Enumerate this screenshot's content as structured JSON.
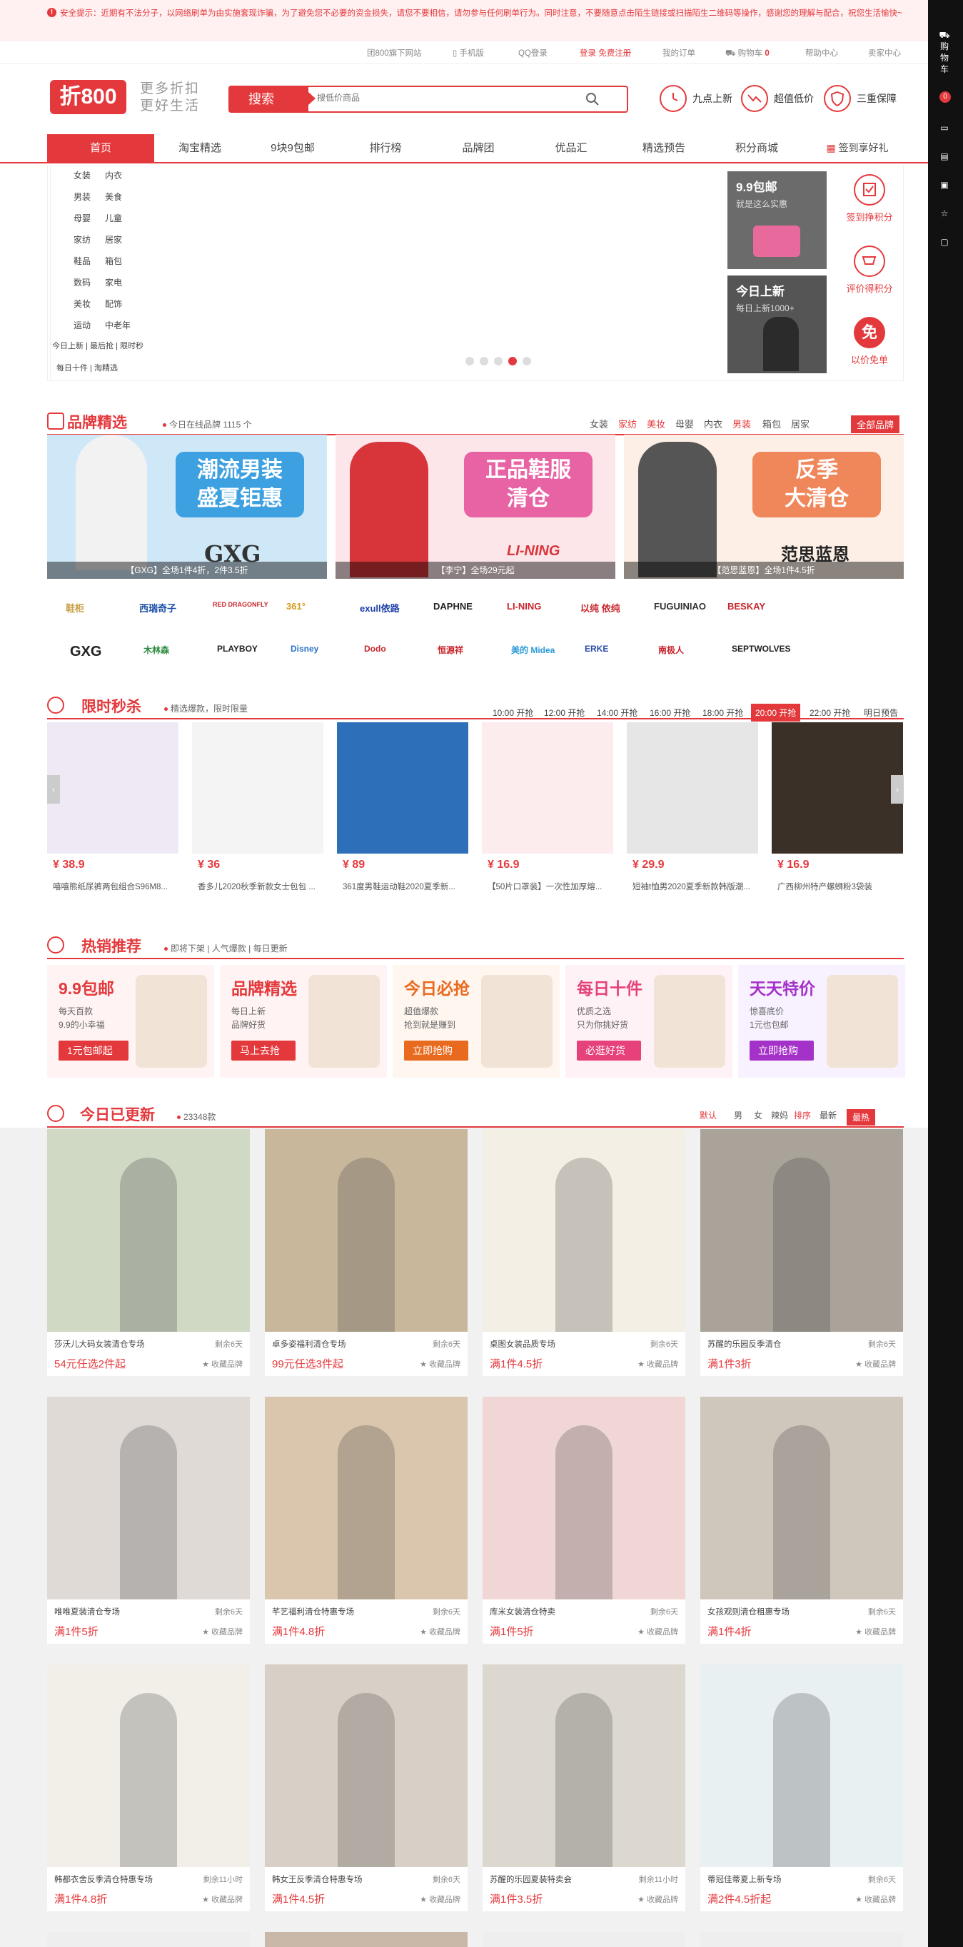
{
  "notice": {
    "icon": "warning-icon",
    "text": "安全提示：近期有不法分子，以网络刷单为由实施套现诈骗，为了避免您不必要的资金损失，请您不要相信，请勿参与任何刷单行为。同时注意，不要随意点击陌生链接或扫描陌生二维码等操作，感谢您的理解与配合，祝您生活愉快~"
  },
  "topbar": {
    "offline": "团800旗下网站",
    "mobile": "手机版",
    "qq": "QQ登录",
    "login": "登录 免费注册",
    "orders": "我的订单",
    "cart": "购物车",
    "cart_count": "0",
    "help": "帮助中心",
    "seller": "卖家中心"
  },
  "header": {
    "logo": "折800",
    "slogan1": "更多折扣",
    "slogan2": "更好生活",
    "search_btn": "搜索",
    "search_placeholder": "搜低价商品",
    "features": [
      "九点上新",
      "超值低价",
      "三重保障"
    ]
  },
  "nav": {
    "items": [
      "首页",
      "淘宝精选",
      "9块9包邮",
      "排行榜",
      "品牌团",
      "优品汇",
      "精选预告",
      "积分商城"
    ],
    "signin": "签到享好礼"
  },
  "categories": [
    [
      "女装",
      "内衣"
    ],
    [
      "男装",
      "美食"
    ],
    [
      "母婴",
      "儿童"
    ],
    [
      "家纺",
      "居家"
    ],
    [
      "鞋品",
      "箱包"
    ],
    [
      "数码",
      "家电"
    ],
    [
      "美妆",
      "配饰"
    ],
    [
      "运动",
      "中老年"
    ]
  ],
  "cat_links1": "今日上新 | 最后抢 | 限时秒",
  "cat_links2": "每日十件 | 淘精选",
  "promo": {
    "box1_title": "9.9包邮",
    "box1_sub": "就是这么实惠",
    "box2_title": "今日上新",
    "box2_sub": "每日上新1000+"
  },
  "services": [
    "签到挣积分",
    "评价得积分",
    "以价免单"
  ],
  "brand": {
    "title": "品牌精选",
    "sub": "今日在线品牌 1115 个",
    "tags": [
      "女装",
      "家纺",
      "美妆",
      "母婴",
      "内衣",
      "男装",
      "箱包",
      "居家"
    ],
    "all": "全部品牌",
    "banners": [
      {
        "line1": "潮流男装",
        "line2": "盛夏钜惠",
        "logo": "GXG",
        "caption": "【GXG】全场1件4折，2件3.5折"
      },
      {
        "line1": "正品鞋服",
        "line2": "清仓",
        "logo": "LI-NING",
        "caption": "【李宁】全场29元起"
      },
      {
        "line1": "反季",
        "line2": "大清仓",
        "logo": "范思蓝恩",
        "caption": "【范思蓝恩】全场1件4.5折"
      }
    ],
    "logos_row1": [
      "鞋柜",
      "西瑞奇子",
      "RED DRAGONFLY",
      "361°",
      "exull依路",
      "DAPHNE",
      "LI-NING",
      "以纯 依纯",
      "FUGUINIAO",
      "BESKAY"
    ],
    "logos_row2": [
      "GXG",
      "木林森",
      "PLAYBOY",
      "Disney",
      "Dodo",
      "恒源祥",
      "美的 Midea",
      "ERKE",
      "南极人",
      "SEPTWOLVES"
    ]
  },
  "flash": {
    "title": "限时秒杀",
    "sub": "精选爆款，限时限量",
    "slots": [
      "10:00 开抢",
      "12:00 开抢",
      "14:00 开抢",
      "16:00 开抢",
      "18:00 开抢",
      "20:00 开抢",
      "22:00 开抢",
      "明日预告"
    ],
    "products": [
      {
        "price": "¥ 38.9",
        "name": "嘻嘻熊纸尿裤两包组合S96M8..."
      },
      {
        "price": "¥ 36",
        "name": "香多儿2020秋季新款女士包包 ..."
      },
      {
        "price": "¥ 89",
        "name": "361度男鞋运动鞋2020夏季新..."
      },
      {
        "price": "¥ 16.9",
        "name": "【50片口罩装】一次性加厚熔..."
      },
      {
        "price": "¥ 29.9",
        "name": "短袖t恤男2020夏季新款韩版潮..."
      },
      {
        "price": "¥ 16.9",
        "name": "广西柳州特产螺蛳粉3袋装"
      }
    ]
  },
  "hot": {
    "title": "热销推荐",
    "sub": "即将下架 | 人气爆款 | 每日更新",
    "cards": [
      {
        "t": "9.9包邮",
        "s1": "每天百款",
        "s2": "9.9的小幸福",
        "b": "1元包邮起"
      },
      {
        "t": "品牌精选",
        "s1": "每日上新",
        "s2": "品牌好货",
        "b": "马上去抢"
      },
      {
        "t": "今日必抢",
        "s1": "超值爆款",
        "s2": "抢到就是赚到",
        "b": "立即抢购"
      },
      {
        "t": "每日十件",
        "s1": "优质之选",
        "s2": "只为你挑好货",
        "b": "必逛好货"
      },
      {
        "t": "天天特价",
        "s1": "惊喜底价",
        "s2": "1元也包邮",
        "b": "立即抢购"
      }
    ]
  },
  "today": {
    "title": "今日已更新",
    "count": "23348款",
    "sorts": [
      "默认",
      "男",
      "女",
      "辣妈",
      "排序",
      "最新",
      "最热"
    ],
    "items": [
      {
        "nm": "莎沃儿大码女装清仓专场",
        "rm": "剩余6天",
        "pr": "54元任选2件起"
      },
      {
        "nm": "卓多姿福利清仓专场",
        "rm": "剩余6天",
        "pr": "99元任选3件起"
      },
      {
        "nm": "桌图女装品质专场",
        "rm": "剩余6天",
        "pr": "满1件4.5折"
      },
      {
        "nm": "苏醒的乐园反季清仓",
        "rm": "剩余6天",
        "pr": "满1件3折"
      },
      {
        "nm": "唯唯夏装清仓专场",
        "rm": "剩余6天",
        "pr": "满1件5折"
      },
      {
        "nm": "芊艺福利清仓特惠专场",
        "rm": "剩余6天",
        "pr": "满1件4.8折"
      },
      {
        "nm": "库米女装清仓特卖",
        "rm": "剩余6天",
        "pr": "满1件5折"
      },
      {
        "nm": "女孩观则清仓租惠专场",
        "rm": "剩余6天",
        "pr": "满1件4折"
      },
      {
        "nm": "韩都衣舍反季清仓特惠专场",
        "rm": "剩余11小时",
        "pr": "满1件4.8折"
      },
      {
        "nm": "韩女王反季清仓特惠专场",
        "rm": "剩余6天",
        "pr": "满1件4.5折"
      },
      {
        "nm": "苏醒的乐园夏装特卖会",
        "rm": "剩余11小时",
        "pr": "满1件3.5折"
      },
      {
        "nm": "蒂冠佳蒂夏上新专场",
        "rm": "剩余6天",
        "pr": "满2件4.5折起"
      }
    ],
    "fav": "收藏品牌"
  },
  "rail": {
    "cart": "购物车",
    "count": "0"
  }
}
